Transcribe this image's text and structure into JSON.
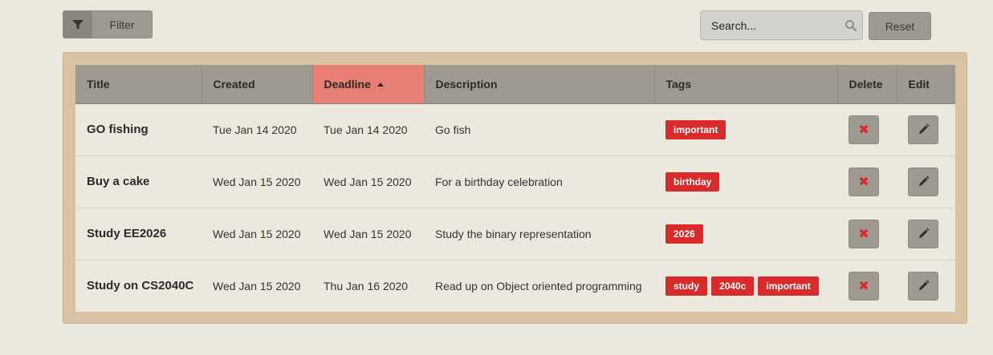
{
  "toolbar": {
    "filter_label": "Filter",
    "filter_icon": "funnel-icon",
    "search_placeholder": "Search...",
    "reset_label": "Reset"
  },
  "table": {
    "columns": [
      "Title",
      "Created",
      "Deadline",
      "Description",
      "Tags",
      "Delete",
      "Edit"
    ],
    "sorted_column": "Deadline",
    "sort_direction": "ascending",
    "rows": [
      {
        "title": "GO fishing",
        "created": "Tue Jan 14 2020",
        "deadline": "Tue Jan 14 2020",
        "description": "Go fish",
        "tags": [
          "important"
        ]
      },
      {
        "title": "Buy a cake",
        "created": "Wed Jan 15 2020",
        "deadline": "Wed Jan 15 2020",
        "description": "For a birthday celebration",
        "tags": [
          "birthday"
        ]
      },
      {
        "title": "Study EE2026",
        "created": "Wed Jan 15 2020",
        "deadline": "Wed Jan 15 2020",
        "description": "Study the binary representation",
        "tags": [
          "2026"
        ]
      },
      {
        "title": "Study on CS2040C",
        "created": "Wed Jan 15 2020",
        "deadline": "Thu Jan 16 2020",
        "description": "Read up on Object oriented programming",
        "tags": [
          "study",
          "2040c",
          "important"
        ]
      }
    ]
  },
  "colors": {
    "background": "#ebe8dd",
    "panel": "#d7c3a2",
    "header": "#9e9a91",
    "sorted_header": "#e87f72",
    "tag": "#d92b2b"
  }
}
